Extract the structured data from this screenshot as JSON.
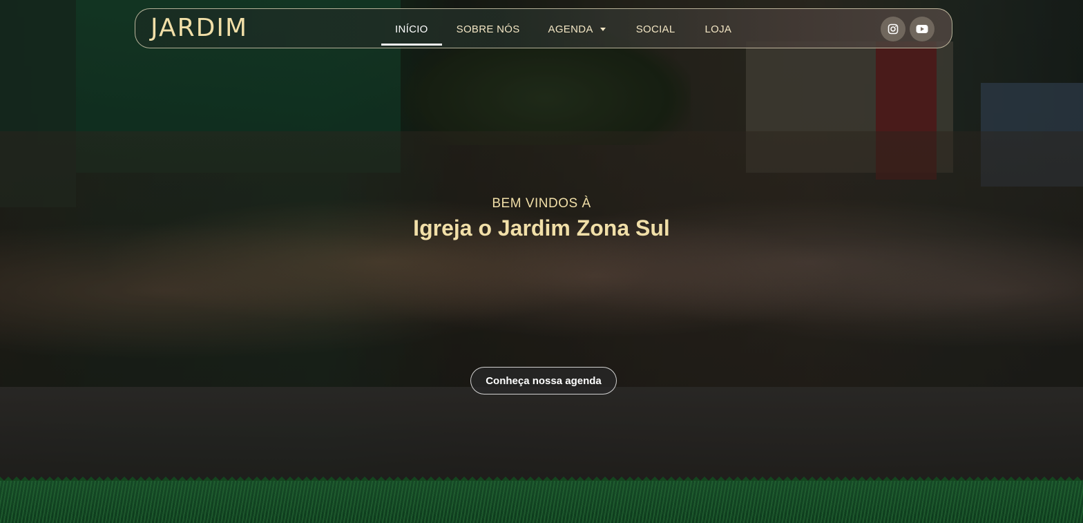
{
  "nav": {
    "logo": "JARDIM",
    "items": [
      {
        "label": "INÍCIO",
        "active": true
      },
      {
        "label": "SOBRE NÓS",
        "active": false
      },
      {
        "label": "AGENDA",
        "active": false,
        "dropdown": true
      },
      {
        "label": "SOCIAL",
        "active": false
      },
      {
        "label": "LOJA",
        "active": false
      }
    ],
    "socials": [
      {
        "icon": "instagram-icon"
      },
      {
        "icon": "youtube-icon"
      }
    ]
  },
  "hero": {
    "kicker": "BEM VINDOS À",
    "title": "Igreja o Jardim Zona Sul",
    "cta_label": "Conheça nossa agenda"
  },
  "colors": {
    "accent_text": "#f1dfa8",
    "nav_border": "#e6dcbe",
    "active_underline": "#f2f2f2",
    "grass": "#164a27"
  }
}
